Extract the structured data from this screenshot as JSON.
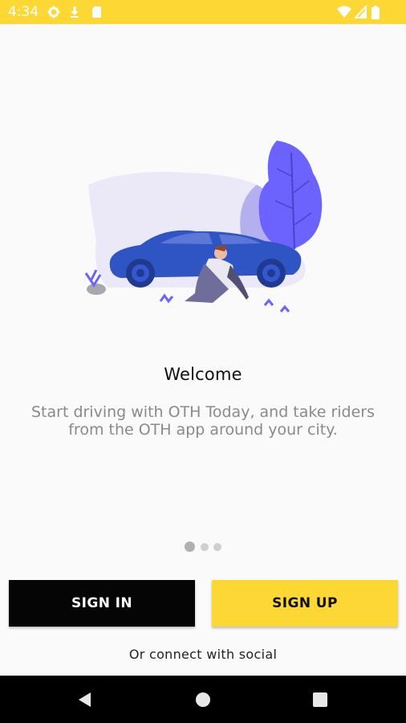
{
  "status_bar": {
    "time": "4:34",
    "background": "#fdd835",
    "icons": [
      "gear-icon",
      "download-icon",
      "sd-card-icon",
      "wifi-icon",
      "signal-icon",
      "battery-icon"
    ]
  },
  "illustration": {
    "icon": "car-person-illustration",
    "colors": {
      "car": "#2f54c4",
      "tree": "#6c63ff",
      "blob": "#ebe9f7"
    }
  },
  "welcome": {
    "title": "Welcome",
    "description_line1": "Start driving with OTH Today, and take riders",
    "description_line2": "from the OTH app around your city."
  },
  "pager": {
    "active_index": 0,
    "count": 3
  },
  "buttons": {
    "sign_in": "SIGN IN",
    "sign_up": "SIGN UP",
    "sign_in_color": "#050505",
    "sign_up_color": "#fdd835"
  },
  "social": {
    "label": "Or connect with social"
  },
  "nav_bar": {
    "icons": [
      "back-icon",
      "home-icon",
      "recents-icon"
    ]
  }
}
